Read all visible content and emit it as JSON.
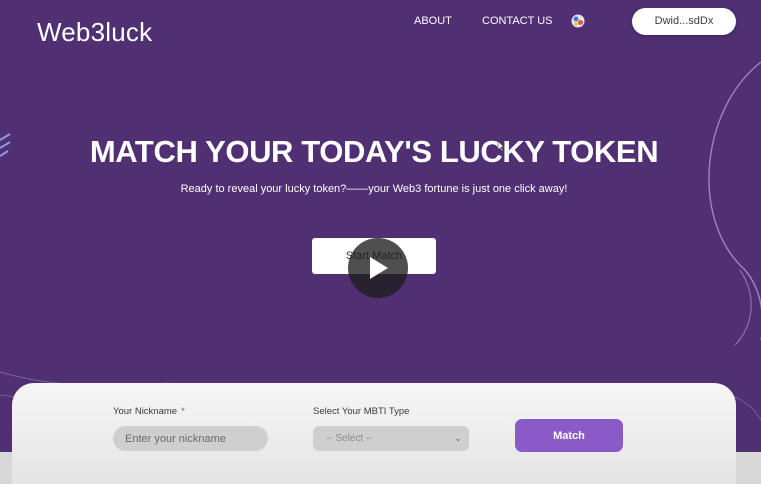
{
  "header": {
    "logo": "Web3luck",
    "nav": {
      "about": "ABOUT",
      "contact": "CONTACT US"
    },
    "language_icon": "globe-language-icon",
    "wallet_label": "Dwid...sdDx"
  },
  "hero": {
    "title": "MATCH YOUR TODAY'S LUCKY TOKEN",
    "subtitle": "Ready to reveal your lucky token?——your Web3 fortune is just one click away!",
    "start_label": "Start Match",
    "play_icon": "play-icon"
  },
  "form": {
    "nickname_label": "Your Nickname",
    "required_mark": "*",
    "nickname_placeholder": "Enter your nickname",
    "mbti_label": "Select Your MBTI Type",
    "mbti_selected": "-- Select --",
    "match_label": "Match"
  },
  "colors": {
    "background": "#502f73",
    "accent_button": "#8a5ac9",
    "card": "#f0f0f0"
  }
}
